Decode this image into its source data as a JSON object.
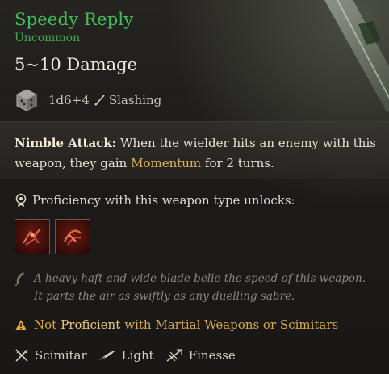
{
  "item": {
    "name": "Speedy Reply",
    "rarity": "Uncommon",
    "damage": "5~10 Damage",
    "dice": "1d6+4",
    "damage_type": "Slashing"
  },
  "description": {
    "keyword": "Nimble Attack:",
    "text_before": " When the wielder hits an enemy with this weapon, they gain ",
    "highlight": "Momentum",
    "text_after": " for 2 turns."
  },
  "proficiency": {
    "label": "Proficiency with this weapon type unlocks:",
    "skills": [
      "skill-1",
      "skill-2"
    ]
  },
  "lore": "A heavy haft and wide blade belie the speed of this weapon. It parts the air as swiftly as any duelling sabre.",
  "warning": {
    "not": "Not",
    "proficient": "Proficient",
    "rest": "with Martial Weapons or Scimitars"
  },
  "properties": [
    {
      "label": "Scimitar",
      "icon": "crossed-swords-icon"
    },
    {
      "label": "Light",
      "icon": "feather-icon"
    },
    {
      "label": "Finesse",
      "icon": "finesse-icon"
    }
  ],
  "colors": {
    "name": "#3fbf5a",
    "rarity": "#3da852",
    "highlight": "#d9b35a",
    "warning": "#e0a83a"
  }
}
